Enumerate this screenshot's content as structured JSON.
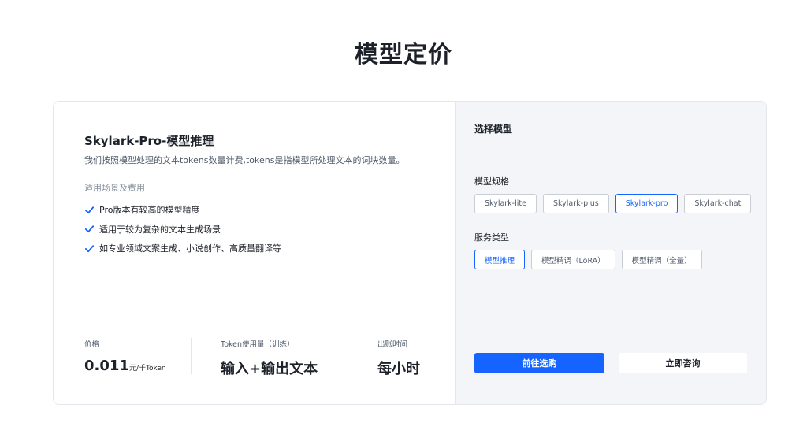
{
  "page": {
    "title": "模型定价"
  },
  "product": {
    "title": "Skylark-Pro-模型推理",
    "description": "我们按照模型处理的文本tokens数量计费,tokens是指模型所处理文本的词块数量。",
    "scenes_title": "适用场景及费用",
    "features": [
      "Pro版本有较高的模型精度",
      "适用于较为复杂的文本生成场景",
      "如专业领域文案生成、小说创作、高质量翻译等"
    ]
  },
  "stats": {
    "price": {
      "label": "价格",
      "value": "0.011",
      "unit": "元/千Token"
    },
    "token_usage": {
      "label": "Token使用量（训练）",
      "value": "输入+输出文本"
    },
    "billing_time": {
      "label": "出账时间",
      "value": "每小时"
    }
  },
  "selector": {
    "title": "选择模型",
    "spec_label": "模型规格",
    "spec_options": [
      "Skylark-lite",
      "Skylark-plus",
      "Skylark-pro",
      "Skylark-chat"
    ],
    "spec_selected": "Skylark-pro",
    "service_label": "服务类型",
    "service_options": [
      "模型推理",
      "模型精调（LoRA）",
      "模型精调（全量）"
    ],
    "service_selected": "模型推理",
    "buy_button": "前往选购",
    "consult_button": "立即咨询"
  },
  "colors": {
    "accent": "#1664ff",
    "panel_bg": "#f3f5f9",
    "border": "#e5e6eb"
  }
}
